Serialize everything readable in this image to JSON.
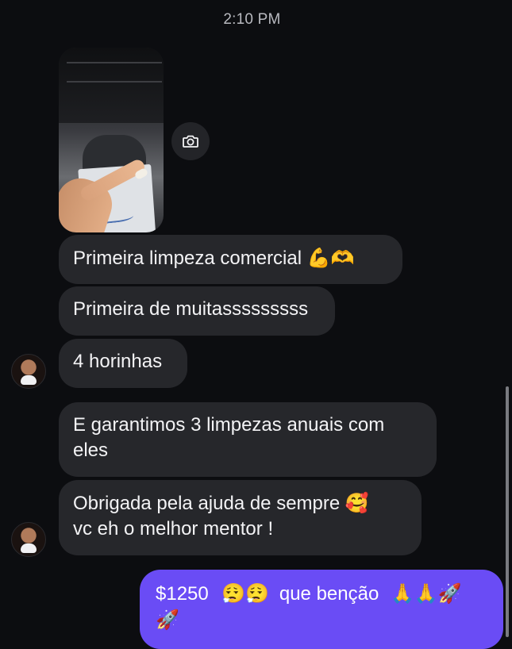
{
  "thread": {
    "timestamp": "2:10 PM"
  },
  "photo_message": {
    "camera_icon": "camera-icon"
  },
  "messages": [
    {
      "text": "Primeira limpeza comercial",
      "emoji": "💪🫶"
    },
    {
      "text": "Primeira de muitasssssssss"
    },
    {
      "text": "4 horinhas"
    },
    {
      "text": "E garantimos 3 limpezas anuais com eles"
    },
    {
      "text": "Obrigada pela ajuda de sempre",
      "emoji": "🥰",
      "text2": "vc eh o melhor mentor !"
    }
  ],
  "outgoing": {
    "amount": "$1250",
    "emoji1": "😮‍💨😮‍💨",
    "text": "que benção",
    "emoji2": "🙏🙏🚀",
    "emoji3": "🚀"
  },
  "colors": {
    "background": "#0c0d10",
    "incoming_bubble": "#26272b",
    "outgoing_bubble": "#6a4cf5",
    "timestamp_text": "#b8b9bf"
  }
}
